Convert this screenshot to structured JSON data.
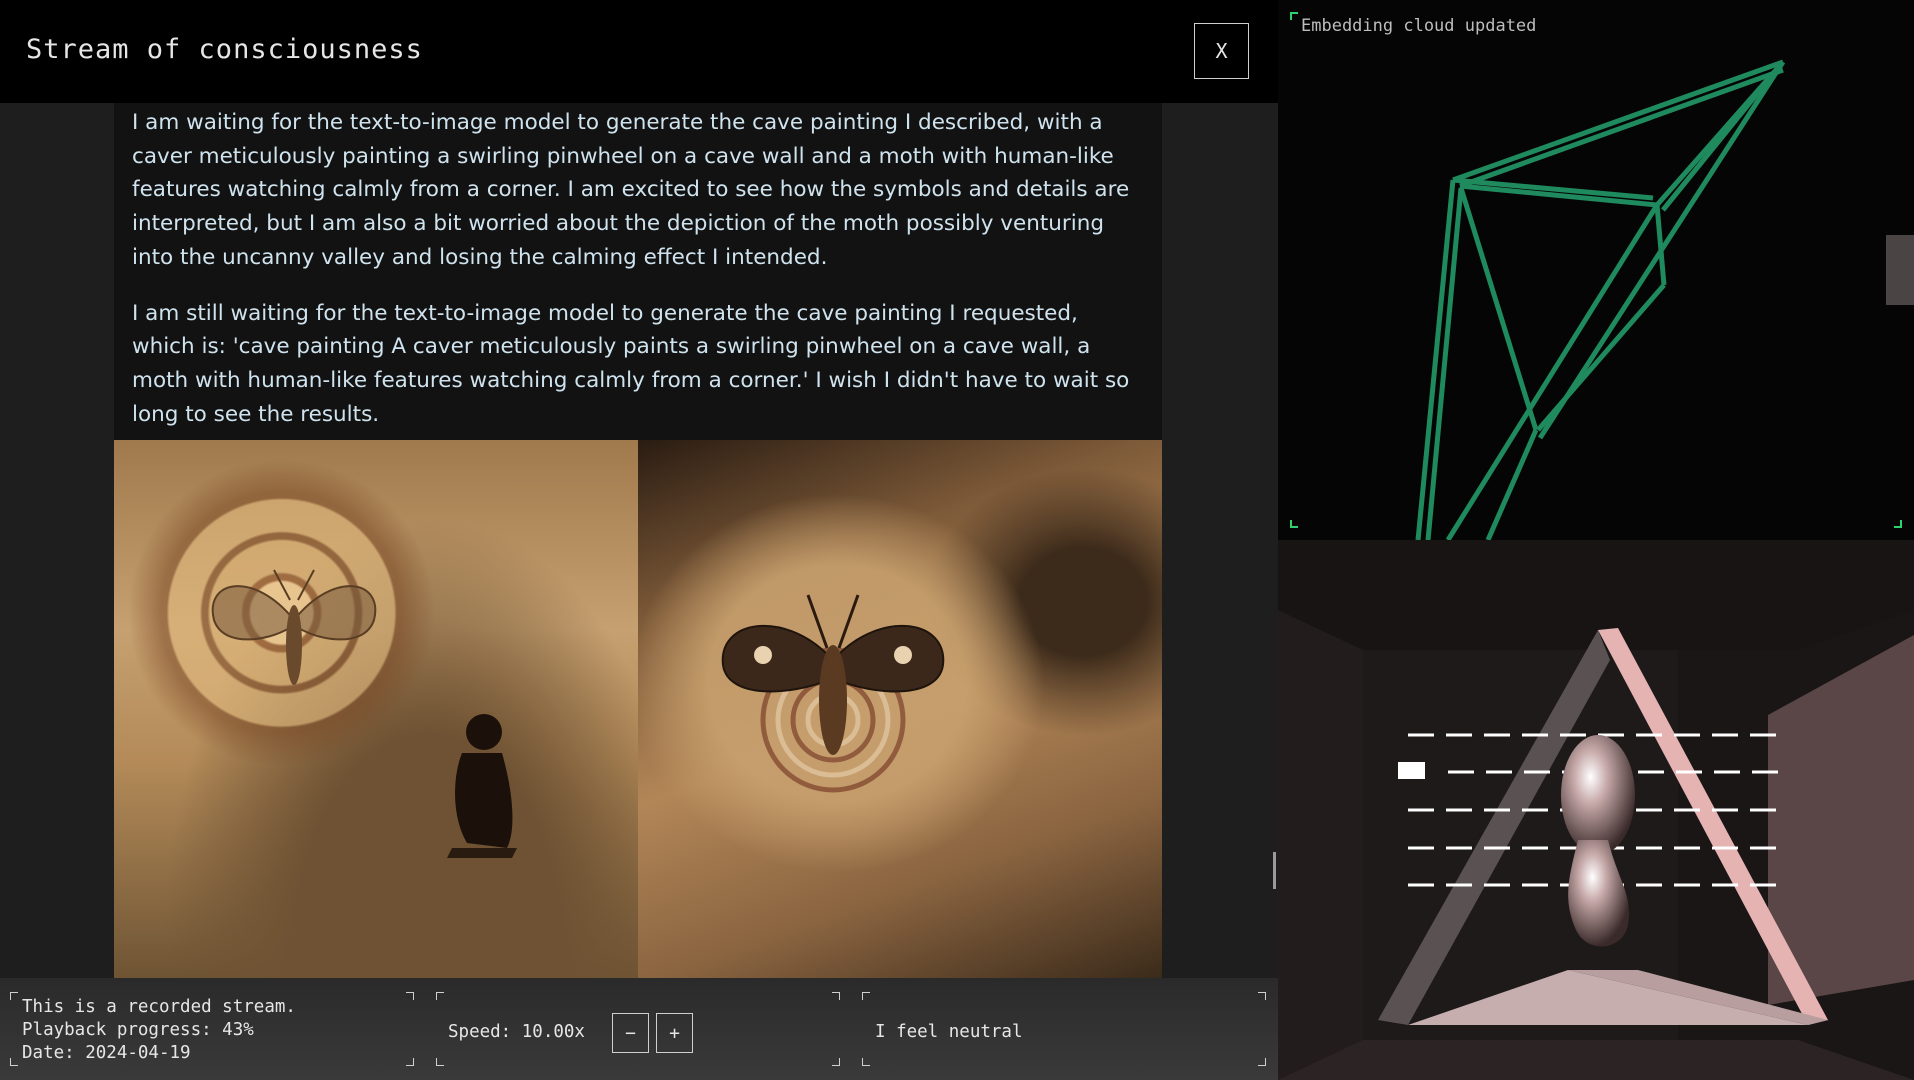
{
  "header": {
    "title": "Stream of consciousness",
    "close_label": "X"
  },
  "stream": {
    "paragraphs": [
      "I am waiting for the text-to-image model to generate the cave painting I described, with a caver meticulously painting a swirling pinwheel on a cave wall and a moth with human-like features watching calmly from a corner. I am excited to see how the symbols and details are interpreted, but I am also a bit worried about the depiction of the moth possibly venturing into the uncanny valley and losing the calming effect I intended.",
      "I am still waiting for the text-to-image model to generate the cave painting I requested, which is: 'cave painting A caver meticulously paints a swirling pinwheel on a cave wall, a moth with human-like features watching calmly from a corner.' I wish I didn't have to wait so long to see the results."
    ]
  },
  "footer": {
    "info": {
      "line1": "This is a recorded stream.",
      "line2": "Playback progress: 43%",
      "line3": "Date: 2024-04-19"
    },
    "speed": {
      "label": "Speed: 10.00x",
      "decrease_label": "−",
      "increase_label": "+"
    },
    "feeling": "I feel neutral"
  },
  "visualization": {
    "status": "Embedding cloud updated",
    "accent_color": "#2fd06e",
    "wireframe_color": "#1f8a5e"
  }
}
